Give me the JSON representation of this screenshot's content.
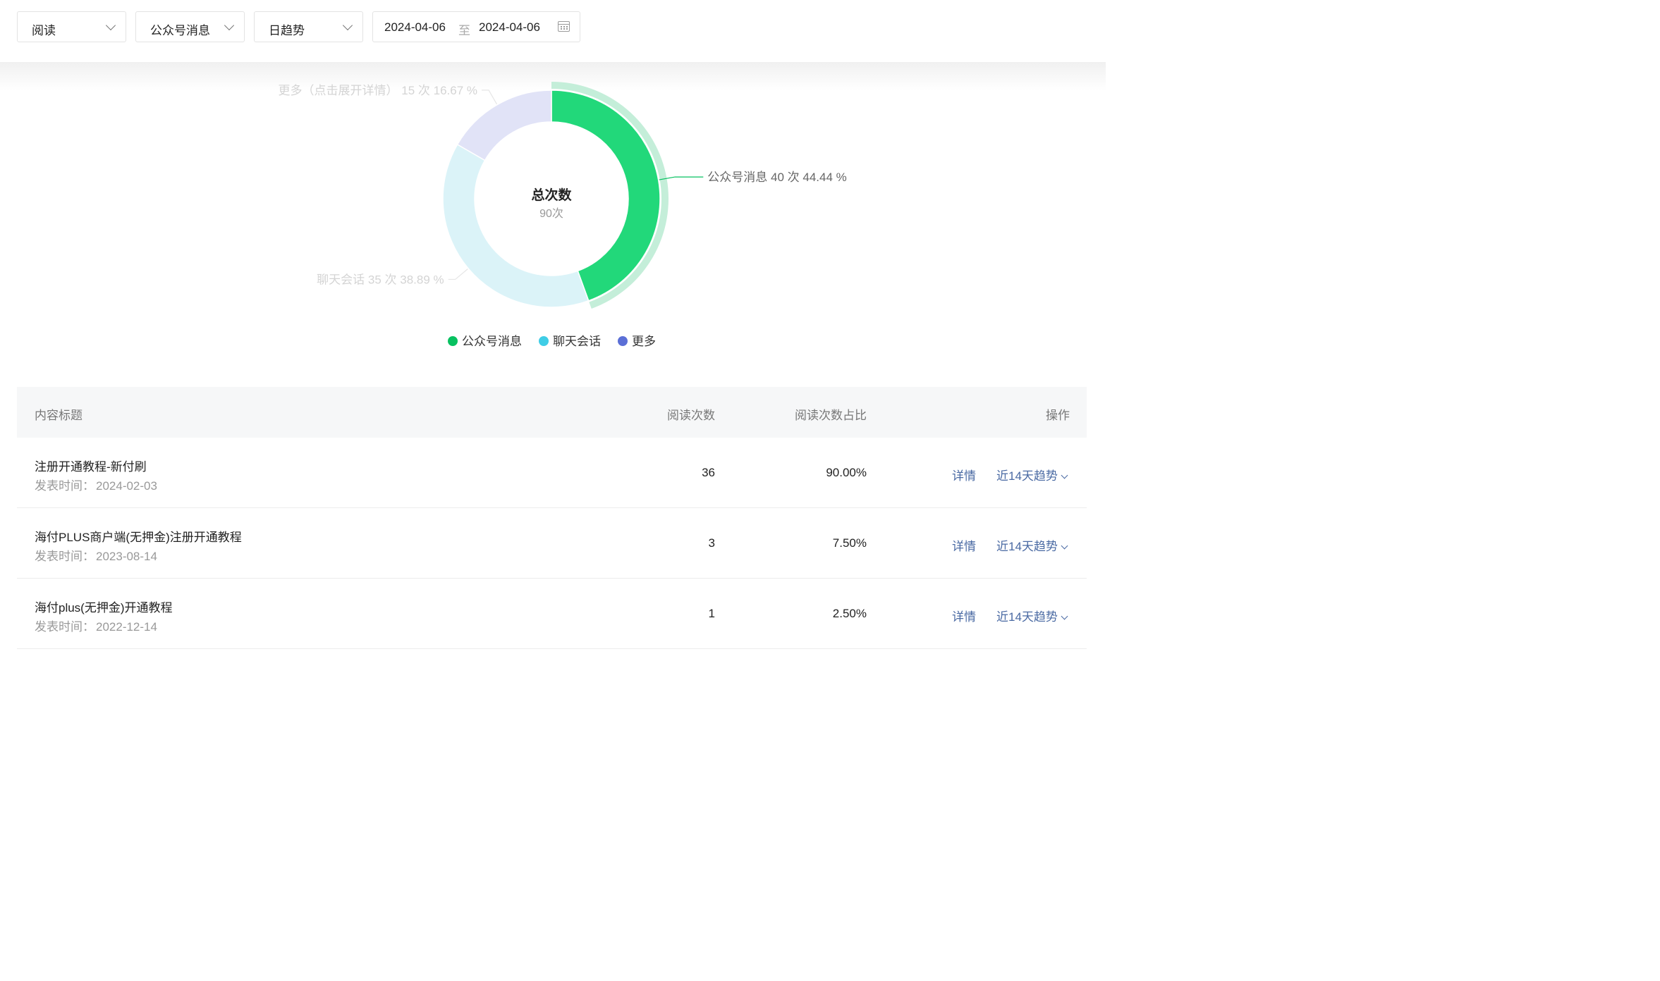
{
  "filters": {
    "metric": "阅读",
    "source": "公众号消息",
    "trend": "日趋势",
    "date_start": "2024-04-06",
    "date_separator": "至",
    "date_end": "2024-04-06"
  },
  "chart_data": {
    "type": "pie",
    "center_title": "总次数",
    "center_value": "90次",
    "slices": [
      {
        "name": "公众号消息",
        "value": 40,
        "percent": 44.44,
        "label": "公众号消息 40 次 44.44 %",
        "color": "#22d87a",
        "highlighted": true
      },
      {
        "name": "聊天会话",
        "value": 35,
        "percent": 38.89,
        "label": "聊天会话 35 次 38.89 %",
        "color": "#dbf3f8",
        "highlighted": false
      },
      {
        "name": "更多",
        "value": 15,
        "percent": 16.67,
        "label": "更多（点击展开详情） 15 次 16.67 %",
        "color": "#e1e3f7",
        "highlighted": false
      }
    ],
    "legend": [
      {
        "name": "公众号消息",
        "color": "#07c160"
      },
      {
        "name": "聊天会话",
        "color": "#3fcde6"
      },
      {
        "name": "更多",
        "color": "#5b6fd6"
      }
    ],
    "legend_position": "bottom"
  },
  "table": {
    "headers": {
      "title": "内容标题",
      "reads": "阅读次数",
      "ratio": "阅读次数占比",
      "action": "操作"
    },
    "rows": [
      {
        "title": "注册开通教程-新付刷",
        "date_label": "发表时间：",
        "date": "2024-02-03",
        "reads": "36",
        "ratio": "90.00%"
      },
      {
        "title": "海付PLUS商户端(无押金)注册开通教程",
        "date_label": "发表时间：",
        "date": "2023-08-14",
        "reads": "3",
        "ratio": "7.50%"
      },
      {
        "title": "海付plus(无押金)开通教程",
        "date_label": "发表时间：",
        "date": "2022-12-14",
        "reads": "1",
        "ratio": "2.50%"
      }
    ],
    "actions": {
      "detail": "详情",
      "trend": "近14天趋势"
    }
  }
}
